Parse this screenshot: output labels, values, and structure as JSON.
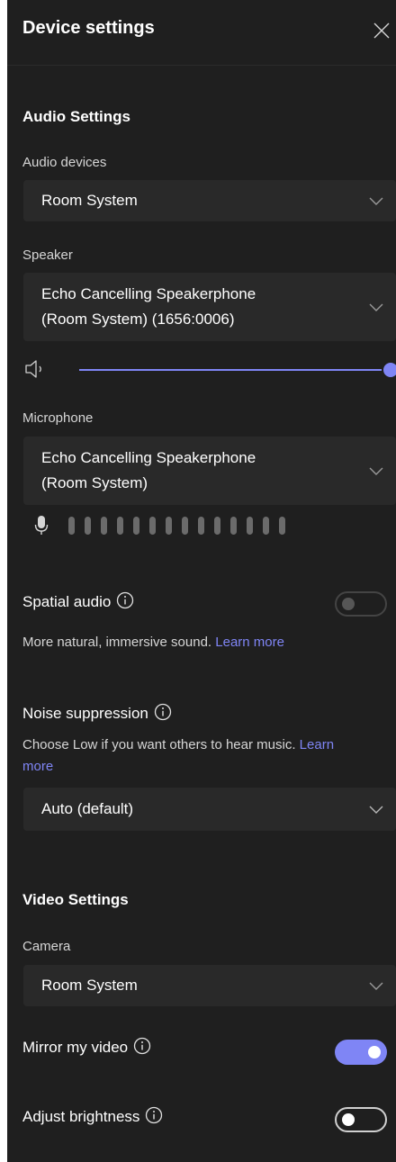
{
  "header": {
    "title": "Device settings"
  },
  "audio": {
    "section_title": "Audio Settings",
    "devices_label": "Audio devices",
    "devices_value": "Room System",
    "speaker_label": "Speaker",
    "speaker_value_line1": "Echo Cancelling Speakerphone",
    "speaker_value_line2": "(Room System) (1656:0006)",
    "volume_level": 1.0,
    "microphone_label": "Microphone",
    "microphone_value_line1": "Echo Cancelling Speakerphone",
    "microphone_value_line2": "(Room System)",
    "mic_level_bars": 14,
    "spatial_audio": {
      "label": "Spatial audio",
      "enabled": false,
      "description": "More natural, immersive sound.",
      "link": "Learn more"
    },
    "noise_suppression": {
      "label": "Noise suppression",
      "description": "Choose Low if you want others to hear music.",
      "link_part1": "Learn",
      "link_part2": "more",
      "value": "Auto (default)"
    }
  },
  "video": {
    "section_title": "Video Settings",
    "camera_label": "Camera",
    "camera_value": "Room System",
    "mirror": {
      "label": "Mirror my video",
      "enabled": true
    },
    "brightness": {
      "label": "Adjust brightness",
      "enabled": false
    }
  },
  "colors": {
    "panel_bg": "#1f1f1f",
    "field_bg": "#292929",
    "accent": "#7f85f5",
    "text": "#ffffff",
    "muted_text": "#d6d6d6"
  },
  "icons": {
    "close": "close-icon",
    "chevron": "chevron-down-icon",
    "speaker": "speaker-icon",
    "mic": "microphone-icon",
    "info": "info-icon"
  }
}
